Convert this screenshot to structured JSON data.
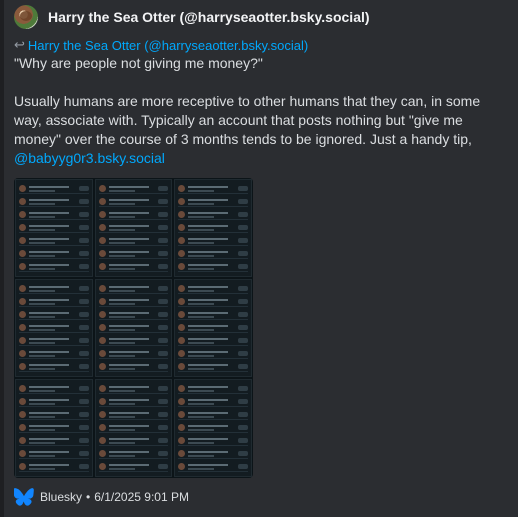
{
  "author": {
    "name": "Harry the Sea Otter (@harryseaotter.bsky.social)"
  },
  "reply": {
    "arrow": "↩",
    "to": "Harry the Sea Otter (@harryseaotter.bsky.social)"
  },
  "post": {
    "quote": "\"Why are people not giving me money?\"",
    "body": "Usually humans are more receptive to other humans that they can, in some way, associate with. Typically an account that posts nothing but \"give me money\" over the course of 3 months tends to be ignored. Just a handy tip,",
    "mention": "@babyyg0r3.bsky.social"
  },
  "footer": {
    "source": "Bluesky",
    "separator": "•",
    "timestamp": "6/1/2025 9:01 PM"
  },
  "colors": {
    "link": "#00a8fc",
    "text": "#dbdee1",
    "background": "#2b2d31",
    "bluesky": "#1185fe"
  },
  "icons": {
    "reply": "reply-arrow-icon",
    "source": "bluesky-butterfly-icon"
  }
}
